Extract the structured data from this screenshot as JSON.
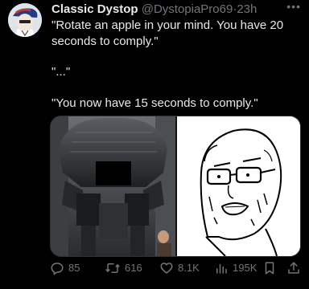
{
  "tweet": {
    "display_name": "Classic Dystop",
    "handle": "@DystopiaPro69",
    "separator": "·",
    "time": "23h",
    "more_icon": "more-icon",
    "paragraphs": [
      "\"Rotate an apple in your mind. You have 20 seconds to comply.\"",
      "\"...\"",
      "\"You now have 15 seconds to comply.\""
    ],
    "media": {
      "left_image": "ed-209-robot-photo",
      "right_image": "wojak-meme-drawing"
    },
    "actions": {
      "replies": "85",
      "reposts": "616",
      "likes": "8.1K",
      "views": "195K"
    }
  },
  "colors": {
    "background": "#000000",
    "text_primary": "#e7e9ea",
    "text_secondary": "#71767b"
  }
}
